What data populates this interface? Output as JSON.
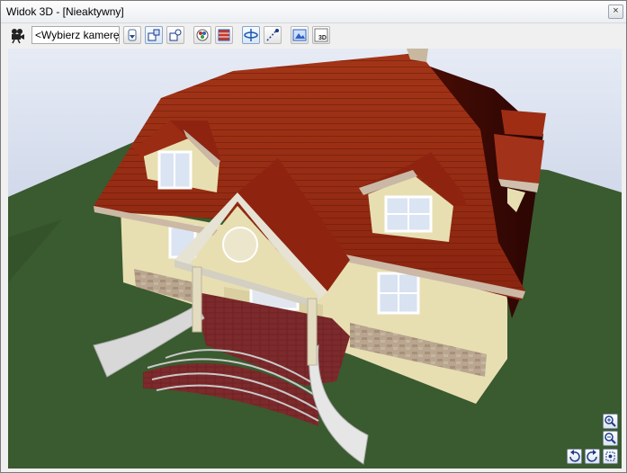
{
  "window": {
    "title": "Widok 3D - [Nieaktywny]",
    "close_glyph": "×"
  },
  "toolbar": {
    "camera_select": {
      "value": "<Wybierz kamerę>"
    },
    "icons": [
      "camera-icon",
      "camera-list-icon",
      "camera-view-icon",
      "camera-target-icon",
      "textures-icon",
      "walls-icon",
      "rotate-icon",
      "walk-icon",
      "render-icon",
      "export-3d-icon"
    ]
  },
  "viewport": {
    "scene": "house-3d-model",
    "nav_buttons": [
      "zoom-in-icon",
      "zoom-out-icon",
      "rotate-left-icon",
      "rotate-right-icon",
      "zoom-extents-icon"
    ]
  },
  "colors": {
    "roof": "#8e2410",
    "wall": "#e8e0b4",
    "grass": "#3a5a2f",
    "sky": "#b8c6e0",
    "brick_floor": "#6a1e20"
  }
}
